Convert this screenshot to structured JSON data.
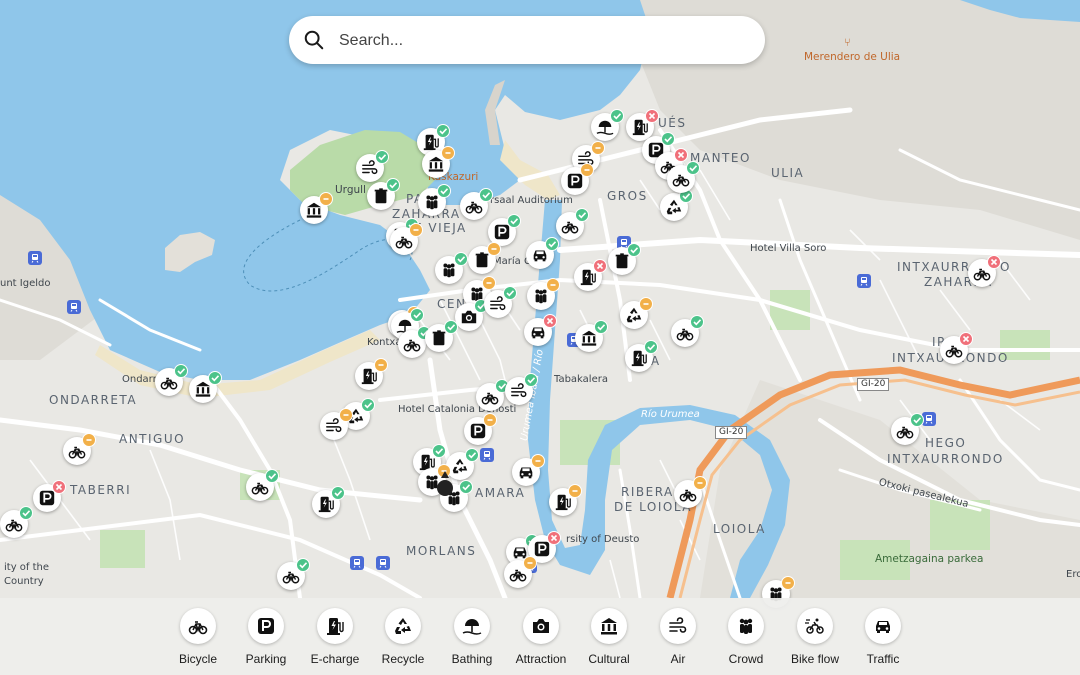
{
  "search": {
    "placeholder": "Search..."
  },
  "map_labels": {
    "merendero": "Merendero de Ulia",
    "ues": "UÉS",
    "manteo": "MANTEO",
    "ulia": "ULIA",
    "kaskazuri": "Kaskazuri",
    "urgull": "Urgull",
    "parte": "PA",
    "zaharra": "ZAHARRA –",
    "vieja": "E VIEJA",
    "kursaal": "rsaal Auditorium",
    "gros": "GROS",
    "hotel_villa_soro": "Hotel Villa Soro",
    "intxaurrondo_zaharra_1": "INTXAURRO",
    "intxaurrondo_zaharra_2": "O",
    "zaharra2": "ZAHARRA",
    "maria_cristina": "María Cri",
    "igeldo": "unt Igeldo",
    "intxaurrondo_ip": "IP",
    "intxaurrondo": "INTXAURRONDO",
    "centro": "CENT",
    "kontxa": "Kontxa",
    "ondarreta_beach": "Ondarr",
    "ondarreta": "ONDARRETA",
    "tabakalera": "Tabakalera",
    "egia": "EGIA",
    "hotel_catalonia": "Hotel Catalonia Donosti",
    "rio_urumea": "Río Urumea",
    "urumea_ibaia": "Urumea ibaia / Río",
    "gi20_a": "GI-20",
    "gi20_b": "GI-20",
    "antiguo": "ANTIGUO",
    "hego": "HEGO",
    "hego_intxaurrondo": "INTXAURRONDO",
    "otxoki": "Otxoki pasealekua",
    "ibaeta": "TABERRI",
    "amara": "AMARA",
    "riberas_1": "RIBERA",
    "riberas_2": "DE LOIOLA",
    "loiola": "LOIOLA",
    "univ_1": "ity of the",
    "univ_2": "Country",
    "deusto": "rsity of Deusto",
    "morlans": "MORLANS",
    "ametzagaina": "Ametzagaina parkea",
    "ero": "Ero"
  },
  "categories": [
    {
      "label": "Bicycle",
      "icon": "bicycle-icon"
    },
    {
      "label": "Parking",
      "icon": "parking-icon"
    },
    {
      "label": "E-charge",
      "icon": "ev-charger-icon"
    },
    {
      "label": "Recycle",
      "icon": "recycle-icon"
    },
    {
      "label": "Bathing",
      "icon": "beach-umbrella-icon"
    },
    {
      "label": "Attraction",
      "icon": "camera-icon"
    },
    {
      "label": "Cultural",
      "icon": "museum-icon"
    },
    {
      "label": "Air",
      "icon": "wind-icon"
    },
    {
      "label": "Crowd",
      "icon": "crowd-icon"
    },
    {
      "label": "Bike flow",
      "icon": "bike-flow-icon"
    },
    {
      "label": "Traffic",
      "icon": "car-icon"
    }
  ],
  "markers": [
    {
      "type": "charger",
      "status": "good"
    },
    {
      "type": "crowd",
      "status": "good"
    },
    {
      "type": "wind",
      "status": "good"
    },
    {
      "type": "museum",
      "status": "warn"
    },
    {
      "type": "trash",
      "status": "good"
    },
    {
      "type": "museum",
      "status": "warn"
    },
    {
      "type": "charger",
      "status": "good"
    },
    {
      "type": "crowd",
      "status": "warn"
    },
    {
      "type": "bicycle",
      "status": "good"
    },
    {
      "type": "bicycle",
      "status": "warn"
    },
    {
      "type": "parking",
      "status": "good"
    },
    {
      "type": "bicycle",
      "status": "good"
    },
    {
      "type": "trash",
      "status": "warn"
    },
    {
      "type": "crowd",
      "status": "good"
    },
    {
      "type": "car",
      "status": "good"
    },
    {
      "type": "beach",
      "status": "good"
    },
    {
      "type": "charger",
      "status": "bad"
    },
    {
      "type": "parking",
      "status": "good"
    },
    {
      "type": "bicycle",
      "status": "bad"
    },
    {
      "type": "wind",
      "status": "warn"
    },
    {
      "type": "parking",
      "status": "warn"
    },
    {
      "type": "recycle",
      "status": "good"
    },
    {
      "type": "bicycle",
      "status": "good"
    },
    {
      "type": "trash",
      "status": "good"
    },
    {
      "type": "charger",
      "status": "bad"
    },
    {
      "type": "trash",
      "status": "warn"
    },
    {
      "type": "bicycle",
      "status": "bad"
    },
    {
      "type": "beach",
      "status": "good"
    },
    {
      "type": "camera",
      "status": "good"
    },
    {
      "type": "wind",
      "status": "good"
    },
    {
      "type": "crowd",
      "status": "warn"
    },
    {
      "type": "bicycle",
      "status": "good"
    },
    {
      "type": "trash",
      "status": "good"
    },
    {
      "type": "car",
      "status": "bad"
    },
    {
      "type": "museum",
      "status": "good"
    },
    {
      "type": "recycle",
      "status": "warn"
    },
    {
      "type": "bicycle",
      "status": "good"
    },
    {
      "type": "charger",
      "status": "good"
    },
    {
      "type": "bicycle",
      "status": "bad"
    },
    {
      "type": "charger",
      "status": "warn"
    },
    {
      "type": "bicycle",
      "status": "good"
    },
    {
      "type": "museum",
      "status": "good"
    },
    {
      "type": "recycle",
      "status": "good"
    },
    {
      "type": "wind",
      "status": "warn"
    },
    {
      "type": "bicycle",
      "status": "good"
    },
    {
      "type": "wind",
      "status": "good"
    },
    {
      "type": "parking",
      "status": "warn"
    },
    {
      "type": "charger",
      "status": "good"
    },
    {
      "type": "recycle",
      "status": "good"
    },
    {
      "type": "crowd",
      "status": "warn"
    },
    {
      "type": "car",
      "status": "warn"
    },
    {
      "type": "bicycle",
      "status": "good"
    },
    {
      "type": "parking",
      "status": "bad"
    },
    {
      "type": "bicycle",
      "status": "good"
    },
    {
      "type": "charger",
      "status": "good"
    },
    {
      "type": "charger",
      "status": "warn"
    },
    {
      "type": "crowd",
      "status": "warn"
    },
    {
      "type": "car",
      "status": "good"
    },
    {
      "type": "parking",
      "status": "bad"
    },
    {
      "type": "bicycle",
      "status": "warn"
    },
    {
      "type": "bicycle",
      "status": "warn"
    },
    {
      "type": "bicycle",
      "status": "good"
    },
    {
      "type": "bicycle",
      "status": "warn"
    },
    {
      "type": "crowd",
      "status": "good"
    },
    {
      "type": "bicycle",
      "status": "good"
    }
  ],
  "colors": {
    "water": "#8fc6ea",
    "land": "#e9e8e4",
    "park": "#c8e3b9",
    "road": "#ffffff",
    "highway": "#ef9a5a",
    "good": "#4cc38a",
    "warn": "#f2b049",
    "bad": "#f0707a",
    "station": "#4a6bd6"
  }
}
